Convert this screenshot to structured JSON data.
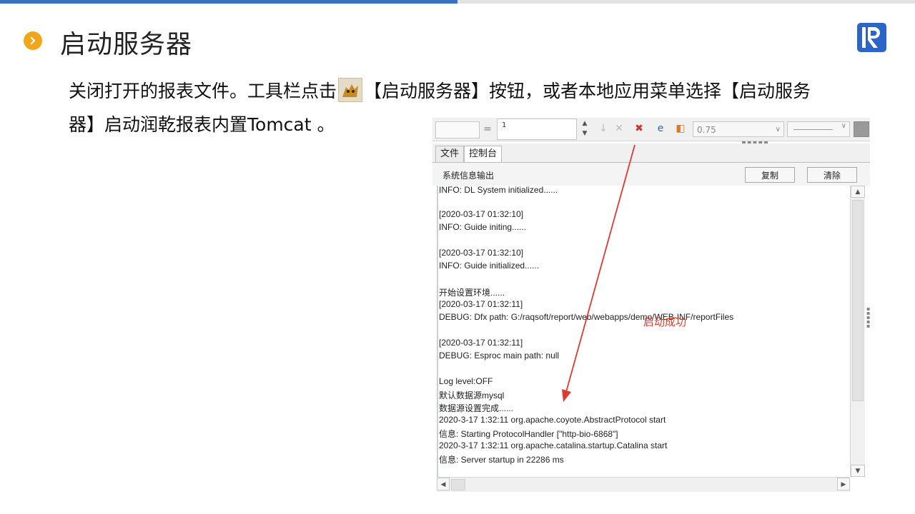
{
  "slide": {
    "title": "启动服务器",
    "para_line1_a": "关闭打开的报表文件。工具栏点击",
    "para_line1_b": "【启动服务器】按钮，或者本地应用菜单选择【启动服务",
    "para_line2": "器】启动润乾报表内置Tomcat 。",
    "colors": {
      "accent_blue": "#3a6fc4",
      "bullet_orange": "#f2a71b",
      "logo_blue": "#2b65c7",
      "annotation_red": "#e03a2e"
    },
    "icons": {
      "bullet": "chevron-right-icon",
      "logo": "raqsoft-logo",
      "inline": "tomcat-icon"
    }
  },
  "screenshot": {
    "toolbar": {
      "field_value": "1",
      "zoom_value": "0.75"
    },
    "tabs": [
      {
        "label": "文件"
      },
      {
        "label": "控制台",
        "active": true
      }
    ],
    "console": {
      "header_label": "系统信息输出",
      "copy_button": "复制",
      "clear_button": "清除"
    },
    "log_lines": [
      "INFO: DL System initialized......",
      "[2020-03-17 01:32:10]",
      "INFO: Guide initing......",
      "[2020-03-17 01:32:10]",
      "INFO: Guide initialized......",
      "开始设置环境......",
      "[2020-03-17 01:32:11]",
      "DEBUG: Dfx path: G:/raqsoft/report/web/webapps/demo/WEB-INF/reportFiles",
      "[2020-03-17 01:32:11]",
      "DEBUG: Esproc main path: null",
      "Log level:OFF",
      "默认数据源mysql",
      "数据源设置完成......",
      "2020-3-17 1:32:11 org.apache.coyote.AbstractProtocol start",
      "信息: Starting ProtocolHandler [\"http-bio-6868\"]",
      "2020-3-17 1:32:11 org.apache.catalina.startup.Catalina start",
      "信息: Server startup in 22286 ms"
    ],
    "annotation": "启动成功"
  }
}
